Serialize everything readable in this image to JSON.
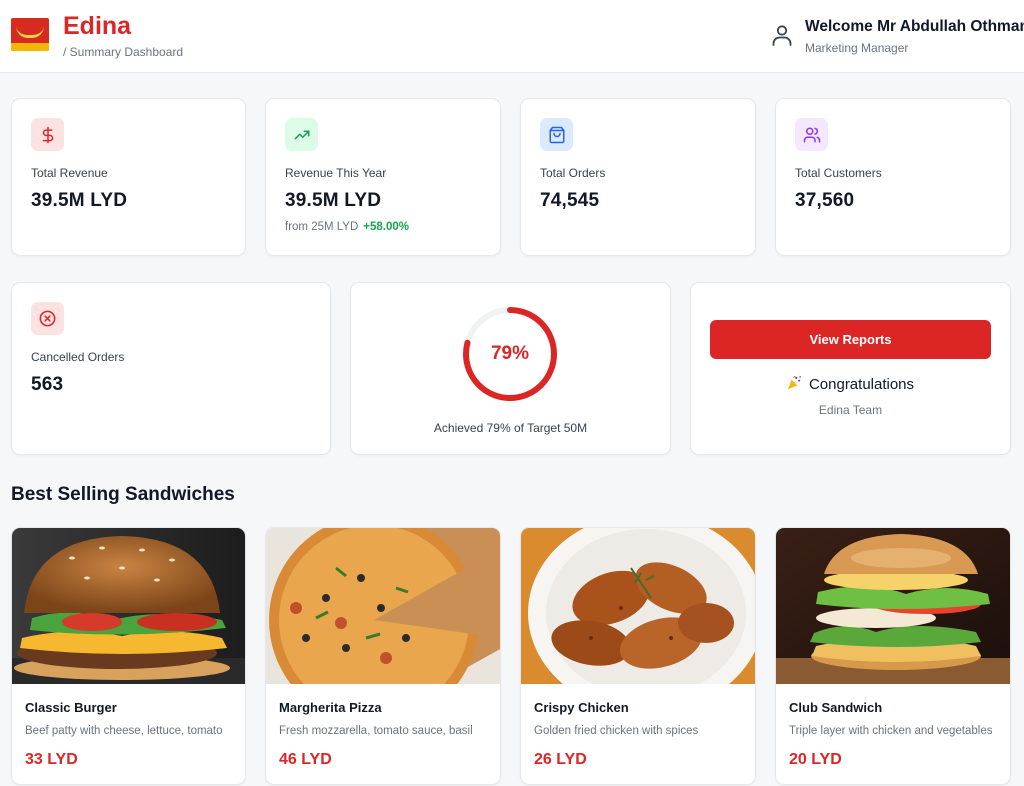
{
  "header": {
    "brand": "Edina",
    "breadcrumb": "/ Summary Dashboard",
    "welcome": "Welcome Mr Abdullah Othman",
    "role": "Marketing Manager",
    "logo_icon": "edina-logo",
    "user_icon": "user-icon"
  },
  "colors": {
    "accent": "#dc2626",
    "positive": "#16a34a",
    "background": "#f6f7f9"
  },
  "stats": [
    {
      "label": "Total Revenue",
      "value": "39.5M LYD",
      "icon": "dollar-icon",
      "icon_color": "#dc2626",
      "icon_bg": "#fde2e2"
    },
    {
      "label": "Revenue This Year",
      "value": "39.5M LYD",
      "sub": "from 25M LYD",
      "change": "+58.00%",
      "icon": "trending-up-icon",
      "icon_color": "#16a34a",
      "icon_bg": "#dcfce7"
    },
    {
      "label": "Total Orders",
      "value": "74,545",
      "icon": "shopping-bag-icon",
      "icon_color": "#2563eb",
      "icon_bg": "#dbeafe"
    },
    {
      "label": "Total Customers",
      "value": "37,560",
      "icon": "users-icon",
      "icon_color": "#9333ea",
      "icon_bg": "#f3e8ff"
    },
    {
      "label": "Cancelled Orders",
      "value": "563",
      "icon": "x-circle-icon",
      "icon_color": "#dc2626",
      "icon_bg": "#fde2e2"
    }
  ],
  "target": {
    "percent_label": "79%",
    "progress": 0.79,
    "caption": "Achieved 79% of Target 50M"
  },
  "actions": {
    "view_reports": "View Reports",
    "congrats": "Congratulations",
    "team": "Edina Team",
    "congrats_icon": "party-popper-icon"
  },
  "section_title": "Best Selling Sandwiches",
  "products": [
    {
      "name": "Classic Burger",
      "desc": "Beef patty with cheese, lettuce, tomato",
      "price": "33 LYD",
      "image": "classic-burger-photo"
    },
    {
      "name": "Margherita Pizza",
      "desc": "Fresh mozzarella, tomato sauce, basil",
      "price": "46 LYD",
      "image": "margherita-pizza-photo"
    },
    {
      "name": "Crispy Chicken",
      "desc": "Golden fried chicken with spices",
      "price": "26 LYD",
      "image": "crispy-chicken-photo"
    },
    {
      "name": "Club Sandwich",
      "desc": "Triple layer with chicken and vegetables",
      "price": "20 LYD",
      "image": "club-sandwich-photo"
    }
  ]
}
